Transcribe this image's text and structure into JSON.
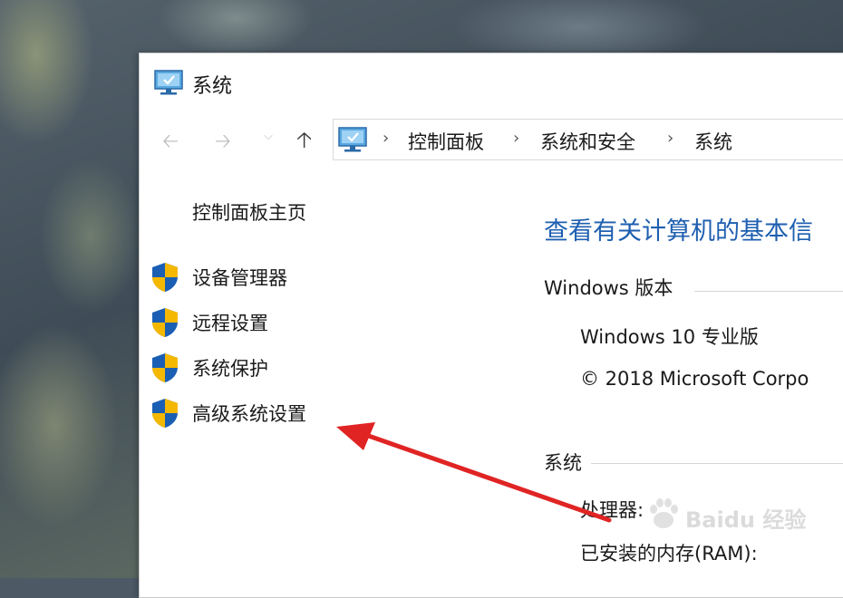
{
  "window": {
    "title": "系统",
    "icon": "computer-monitor-icon"
  },
  "nav": {
    "back_icon": "back-arrow-icon",
    "forward_icon": "forward-arrow-icon",
    "dropdown_icon": "chevron-down-icon",
    "up_icon": "up-arrow-icon",
    "up_glyph": "🡡"
  },
  "breadcrumb": {
    "separator": "›",
    "items": [
      "控制面板",
      "系统和安全",
      "系统"
    ]
  },
  "sidebar": {
    "home_label": "控制面板主页",
    "links": [
      {
        "label": "设备管理器",
        "icon": "shield-icon"
      },
      {
        "label": "远程设置",
        "icon": "shield-icon"
      },
      {
        "label": "系统保护",
        "icon": "shield-icon"
      },
      {
        "label": "高级系统设置",
        "icon": "shield-icon"
      }
    ]
  },
  "main": {
    "heading": "查看有关计算机的基本信",
    "windows_section": {
      "title": "Windows 版本",
      "edition": "Windows 10 专业版",
      "copyright": "© 2018 Microsoft Corpo"
    },
    "system_section": {
      "title": "系统",
      "processor_label": "处理器:",
      "ram_label": "已安装的内存(RAM):"
    }
  },
  "annotation": {
    "arrow_color": "#e02424",
    "arrow_icon": "red-arrow-annotation"
  },
  "watermark": {
    "text": "Baidu 经验",
    "icon": "baidu-paw-logo"
  },
  "colors": {
    "heading": "#1e5fb0",
    "shield_blue": "#1a5fb4",
    "shield_yellow": "#f5b800"
  }
}
